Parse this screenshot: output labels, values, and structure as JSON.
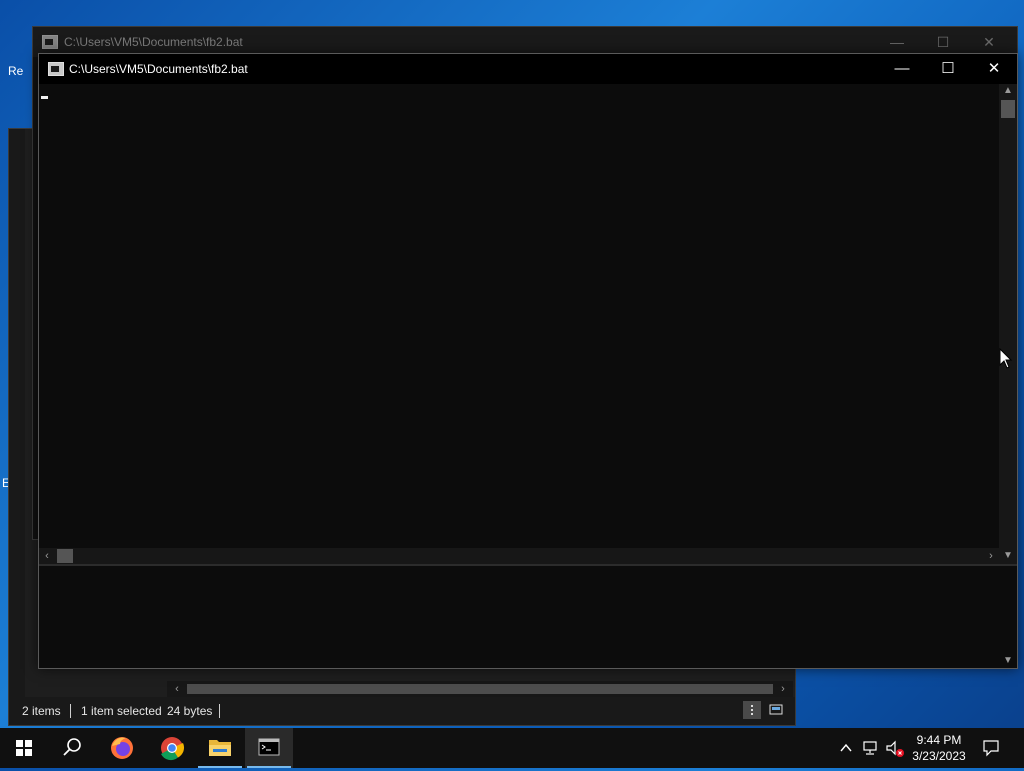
{
  "desktop": {
    "icon_label_1": "Re",
    "icon_label_2": "E"
  },
  "explorer": {
    "status": {
      "items": "2 items",
      "selected": "1 item selected",
      "size": "24 bytes"
    }
  },
  "cmd_back": {
    "title": "C:\\Users\\VM5\\Documents\\fb2.bat"
  },
  "cmd_front": {
    "title": "C:\\Users\\VM5\\Documents\\fb2.bat"
  },
  "window_controls": {
    "minimize": "—",
    "maximize": "☐",
    "close": "✕"
  },
  "scroll_arrows": {
    "up": "▲",
    "down": "▼",
    "left": "‹",
    "right": "›"
  },
  "taskbar": {
    "icons": [
      "windows-start-icon",
      "search-icon",
      "firefox-icon",
      "chrome-icon",
      "file-explorer-icon",
      "command-prompt-icon"
    ],
    "clock": {
      "time": "9:44 PM",
      "date": "3/23/2023"
    }
  },
  "colors": {
    "desktop_blue": "#0b5cb8",
    "console_bg": "#0c0c0c",
    "taskbar_bg": "#101010",
    "active_indicator": "#76b9ed"
  }
}
